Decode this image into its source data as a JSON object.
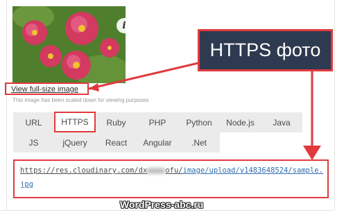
{
  "image": {
    "view_full_size": "View full-size image",
    "scaled_note": "This image has been scaled down for viewing purposes"
  },
  "tabs": {
    "row1": [
      "URL",
      "HTTPS",
      "Ruby",
      "PHP",
      "Python",
      "Node.js",
      "Java"
    ],
    "row2": [
      "JS",
      "jQuery",
      "React",
      "Angular",
      ".Net"
    ],
    "active": "HTTPS"
  },
  "url": {
    "prefix": "https://res.cloudinary.com/dx",
    "after_blur": "ofu/",
    "path_a": "image/upload/",
    "version": "v1483648524/",
    "file": "sample.jpg"
  },
  "callout": {
    "label": "HTTPS фото"
  },
  "watermark": {
    "text": "WordPress-abc.ru"
  },
  "colors": {
    "accent_red": "#e03a3e",
    "callout_bg": "#2e3a4f",
    "link_blue": "#2f6db0"
  },
  "icons": {
    "info": "info-icon"
  }
}
